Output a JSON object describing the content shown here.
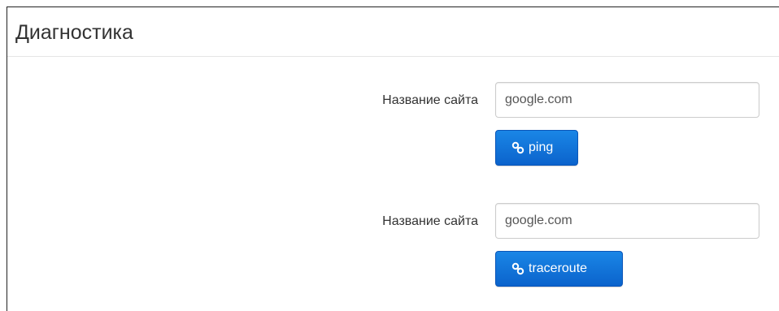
{
  "panel": {
    "title": "Диагностика"
  },
  "ping_form": {
    "label": "Название сайта",
    "input_value": "google.com",
    "button_label": "ping",
    "button_icon": "link-icon"
  },
  "traceroute_form": {
    "label": "Название сайта",
    "input_value": "google.com",
    "button_label": "traceroute",
    "button_icon": "link-icon"
  },
  "colors": {
    "button_primary": "#0b63cc",
    "divider": "#e5e5e5"
  }
}
